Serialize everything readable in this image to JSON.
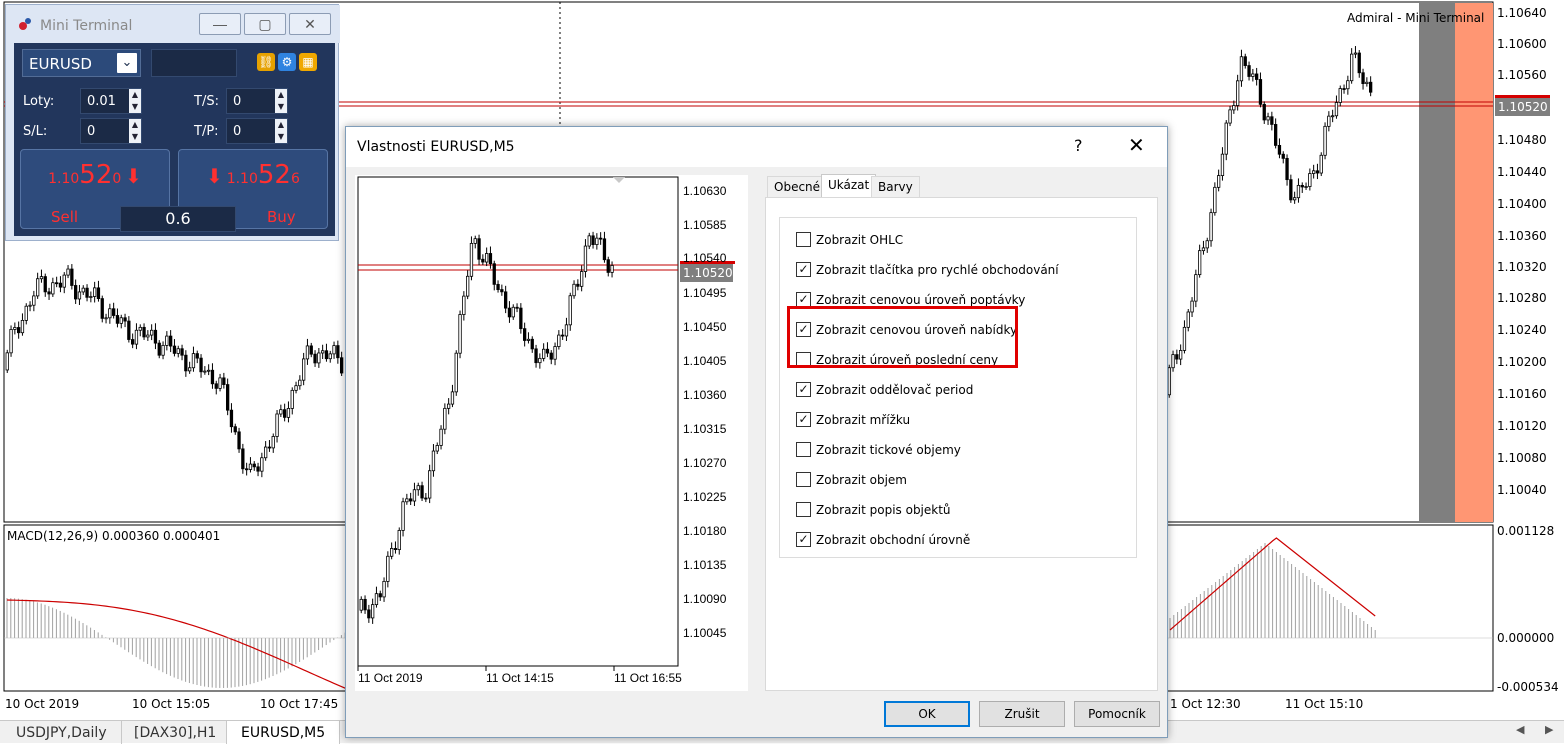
{
  "chart": {
    "title_right": "Admiral - Mini Terminal",
    "price_labels": [
      "1.10640",
      "1.10600",
      "1.10560",
      "1.10480",
      "1.10440",
      "1.10400",
      "1.10360",
      "1.10320",
      "1.10280",
      "1.10240",
      "1.10200",
      "1.10160",
      "1.10120",
      "1.10080",
      "1.10040"
    ],
    "current_price": "1.10520",
    "macd_label": "MACD(12,26,9) 0.000360 0.000401",
    "macd_levels": [
      "0.001128",
      "0.000000",
      "-0.000534"
    ],
    "time_labels": [
      "10 Oct 2019",
      "10 Oct 15:05",
      "10 Oct 17:45",
      "1 Oct 12:30",
      "11 Oct 15:10"
    ]
  },
  "tabs": [
    {
      "label": "USDJPY,Daily"
    },
    {
      "label": "[DAX30],H1"
    },
    {
      "label": "EURUSD,M5"
    }
  ],
  "mini_terminal": {
    "title": "Mini Terminal",
    "symbol": "EURUSD",
    "lots_label": "Loty:",
    "lots_value": "0.01",
    "ts_label": "T/S:",
    "ts_value": "0",
    "sl_label": "S/L:",
    "sl_value": "0",
    "tp_label": "T/P:",
    "tp_value": "0",
    "sell": {
      "prefix": "1.10",
      "big": "52",
      "suffix": "0",
      "label": "Sell"
    },
    "buy": {
      "prefix": "1.10",
      "big": "52",
      "suffix": "6",
      "label": "Buy"
    },
    "spread": "0.6"
  },
  "dialog": {
    "title": "Vlastnosti EURUSD,M5",
    "help": "?",
    "close": "✕",
    "preview": {
      "price_labels": [
        "1.10630",
        "1.10585",
        "1.10540",
        "1.10495",
        "1.10450",
        "1.10405",
        "1.10360",
        "1.10315",
        "1.10270",
        "1.10225",
        "1.10180",
        "1.10135",
        "1.10090",
        "1.10045"
      ],
      "current_price": "1.10520",
      "time_labels": [
        "11 Oct 2019",
        "11 Oct 14:15",
        "11 Oct 16:55"
      ]
    },
    "tabs": [
      "Obecné",
      "Ukázat",
      "Barvy"
    ],
    "active_tab": "Ukázat",
    "checkboxes": [
      {
        "label": "Zobrazit OHLC",
        "checked": false
      },
      {
        "label": "Zobrazit tlačítka pro rychlé obchodování",
        "checked": true
      },
      {
        "label": "Zobrazit cenovou úroveň poptávky",
        "checked": true
      },
      {
        "label": "Zobrazit cenovou úroveň nabídky",
        "checked": true
      },
      {
        "label": "Zobrazit úroveň poslední ceny",
        "checked": false
      },
      {
        "label": "Zobrazit oddělovač period",
        "checked": true
      },
      {
        "label": "Zobrazit mřížku",
        "checked": true
      },
      {
        "label": "Zobrazit  tickové objemy",
        "checked": false
      },
      {
        "label": "Zobrazit objem",
        "checked": false
      },
      {
        "label": "Zobrazit popis objektů",
        "checked": false
      },
      {
        "label": "Zobrazit obchodní úrovně",
        "checked": true
      }
    ],
    "buttons": {
      "ok": "OK",
      "cancel": "Zrušit",
      "help": "Pomocník"
    }
  }
}
